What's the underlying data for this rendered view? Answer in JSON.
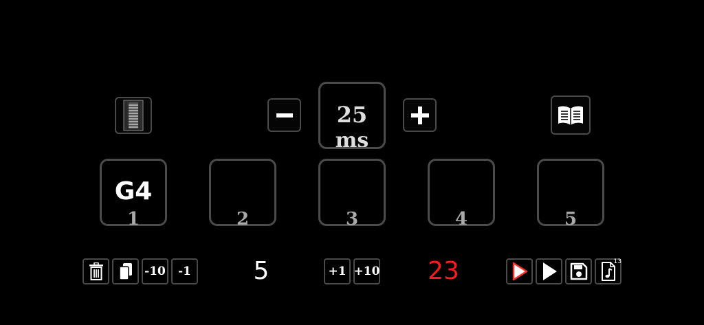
{
  "delay": {
    "value": "25",
    "unit": "ms"
  },
  "slots": [
    {
      "number": "1",
      "note": "G4"
    },
    {
      "number": "2",
      "note": ""
    },
    {
      "number": "3",
      "note": ""
    },
    {
      "number": "4",
      "note": ""
    },
    {
      "number": "5",
      "note": ""
    }
  ],
  "toolbar": {
    "minus10_label": "-10",
    "minus1_label": "-1",
    "plus1_label": "+1",
    "plus10_label": "+10",
    "left_value": "5",
    "right_value": "23",
    "file_badge": "13"
  },
  "colors": {
    "right_value": "#ff1a1a",
    "play_outline": "#ff3030",
    "border": "#4a4a4a"
  },
  "icons": {
    "top_left": "accordion-icon",
    "delay_minus": "minus-icon",
    "delay_plus": "plus-icon",
    "book": "book-open-icon",
    "delete": "trash-icon",
    "copy": "copy-icon",
    "play_outline": "play-outline-icon",
    "play": "play-icon",
    "save": "save-icon",
    "music_file": "music-file-icon"
  }
}
